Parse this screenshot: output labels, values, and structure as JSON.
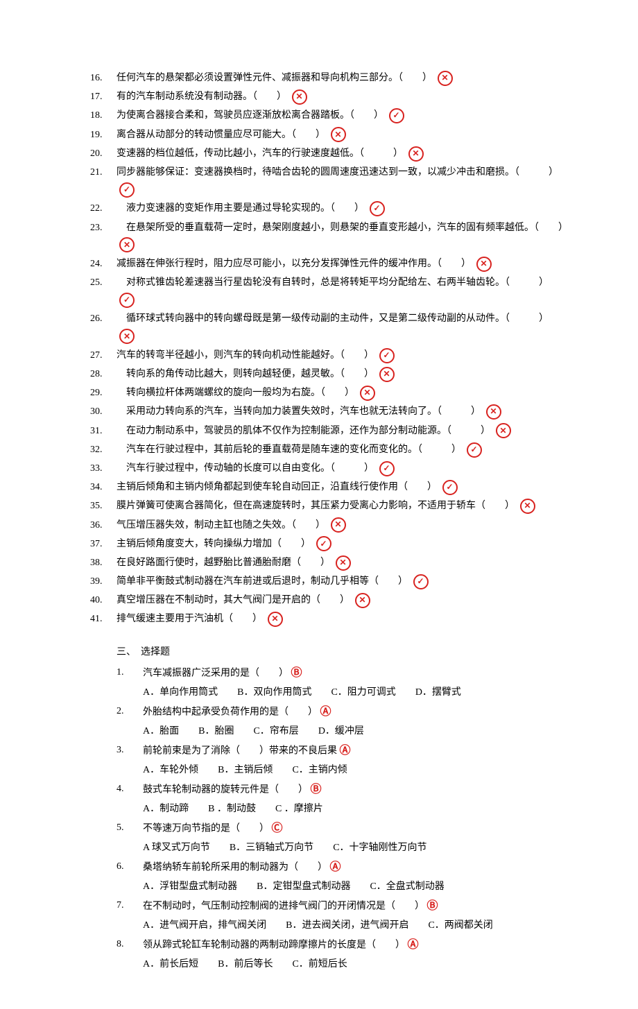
{
  "judgement": [
    {
      "n": "16.",
      "t": "任何汽车的悬架都必须设置弹性元件、减振器和导向机构三部分。（　　）",
      "m": "wrong"
    },
    {
      "n": "17.",
      "t": "有的汽车制动系统没有制动器。（　　）",
      "m": "wrong"
    },
    {
      "n": "18.",
      "t": "为使离合器接合柔和，驾驶员应逐渐放松离合器踏板。（　　）",
      "m": "correct"
    },
    {
      "n": "19.",
      "t": "离合器从动部分的转动惯量应尽可能大。（　　）",
      "m": "wrong"
    },
    {
      "n": "20.",
      "t": "变速器的档位越低，传动比越小，汽车的行驶速度越低。（　　　）",
      "m": "wrong"
    },
    {
      "n": "21.",
      "t": "同步器能够保证：变速器换档时，待啮合齿轮的圆周速度迅速达到一致，以减少冲击和磨损。（　　　）",
      "m": "correct"
    },
    {
      "n": "22.",
      "t": "　液力变速器的变矩作用主要是通过导轮实现的。（　　）",
      "m": "correct"
    },
    {
      "n": "23.",
      "t": "　在悬架所受的垂直载荷一定时，悬架刚度越小，则悬架的垂直变形越小，汽车的固有频率越低。（　　）",
      "m": "wrong"
    },
    {
      "n": "24.",
      "t": "减振器在伸张行程时，阻力应尽可能小，以充分发挥弹性元件的缓冲作用。（　　）",
      "m": "wrong"
    },
    {
      "n": "25.",
      "t": "　对称式锥齿轮差速器当行星齿轮没有自转时，总是将转矩平均分配给左、右两半轴齿轮。（　　　）",
      "m": "correct"
    },
    {
      "n": "26.",
      "t": "　循环球式转向器中的转向螺母既是第一级传动副的主动件，又是第二级传动副的从动件。（　　　）",
      "m": "wrong"
    },
    {
      "n": "27.",
      "t": "汽车的转弯半径越小，则汽车的转向机动性能越好。（　　）",
      "m": "correct"
    },
    {
      "n": "28.",
      "t": "　转向系的角传动比越大，则转向越轻便，越灵敏。（　　）",
      "m": "wrong"
    },
    {
      "n": "29.",
      "t": "　转向横拉杆体两端螺纹的旋向一般均为右旋。（　　）",
      "m": "wrong"
    },
    {
      "n": "30.",
      "t": "　采用动力转向系的汽车，当转向加力装置失效时，汽车也就无法转向了。（　　　）",
      "m": "wrong"
    },
    {
      "n": "31.",
      "t": "　在动力制动系中，驾驶员的肌体不仅作为控制能源，还作为部分制动能源。（　　　）",
      "m": "wrong"
    },
    {
      "n": "32.",
      "t": "　汽车在行驶过程中，其前后轮的垂直载荷是随车速的变化而变化的。（　　　）",
      "m": "correct"
    },
    {
      "n": "33.",
      "t": "　汽车行驶过程中，传动轴的长度可以自由变化。（　　　）",
      "m": "correct"
    },
    {
      "n": "34.",
      "t": "主销后倾角和主销内倾角都起到使车轮自动回正，沿直线行使作用（　　）",
      "m": "correct"
    },
    {
      "n": "35.",
      "t": "膜片弹簧可使离合器简化，但在高速旋转时，其压紧力受离心力影响，不适用于轿车（　　）",
      "m": "wrong"
    },
    {
      "n": "36.",
      "t": "气压增压器失效，制动主缸也随之失效。（　　）",
      "m": "wrong"
    },
    {
      "n": "37.",
      "t": "主销后倾角度变大，转向操纵力增加（　　）",
      "m": "correct"
    },
    {
      "n": "38.",
      "t": "在良好路面行使时，越野胎比普通胎耐磨（　　）",
      "m": "wrong"
    },
    {
      "n": "39.",
      "t": "简单非平衡鼓式制动器在汽车前进或后退时，制动几乎相等（　　）",
      "m": "correct"
    },
    {
      "n": "40.",
      "t": "真空增压器在不制动时，其大气阀门是开启的（　　）",
      "m": "wrong"
    },
    {
      "n": "41.",
      "t": "排气缓速主要用于汽油机（　　）",
      "m": "wrong"
    }
  ],
  "section3_title": "三、　选择题",
  "mc": [
    {
      "n": "1.",
      "q": "汽车减振器广泛采用的是（　　）",
      "ans": "Ⓑ",
      "opts": [
        "A．单向作用筒式",
        "B．双向作用筒式",
        "C．阻力可调式",
        "D．摆臂式"
      ]
    },
    {
      "n": "2.",
      "q": "外胎结构中起承受负荷作用的是（　　）",
      "ans": "Ⓐ",
      "opts": [
        "A．胎面",
        "B．胎圈",
        "C．帘布层",
        "D．缓冲层"
      ]
    },
    {
      "n": "3.",
      "q": "前轮前束是为了消除（　　）带来的不良后果",
      "ans": "Ⓐ",
      "opts": [
        "A．车轮外倾",
        "B．主销后倾",
        "C．主销内倾"
      ]
    },
    {
      "n": "4.",
      "q": "鼓式车轮制动器的旋转元件是（　　）",
      "ans": "Ⓑ",
      "opts": [
        "A．制动蹄",
        "B ．制动鼓",
        "C ．摩擦片"
      ]
    },
    {
      "n": "5.",
      "q": "不等速万向节指的是（　　）",
      "ans": "Ⓒ",
      "opts": [
        "A 球叉式万向节",
        "B．三销轴式万向节",
        "C．十字轴刚性万向节"
      ]
    },
    {
      "n": "6.",
      "q": "桑塔纳轿车前轮所采用的制动器为（　　）",
      "ans": "Ⓐ",
      "opts": [
        "A．浮钳型盘式制动器",
        "B．定钳型盘式制动器",
        "C．全盘式制动器"
      ]
    },
    {
      "n": "7.",
      "q": "在不制动时，气压制动控制阀的进排气阀门的开闭情况是（　　）",
      "ans": "Ⓑ",
      "opts": [
        "A．进气阀开启，排气阀关闭",
        "B．进去阀关闭，进气阀开启",
        "C．两阀都关闭"
      ]
    },
    {
      "n": "8.",
      "q": "领从蹄式轮缸车轮制动器的两制动蹄摩擦片的长度是（　　）",
      "ans": "Ⓐ",
      "opts": [
        "A．前长后短",
        "B．前后等长",
        "C．前短后长"
      ]
    }
  ]
}
